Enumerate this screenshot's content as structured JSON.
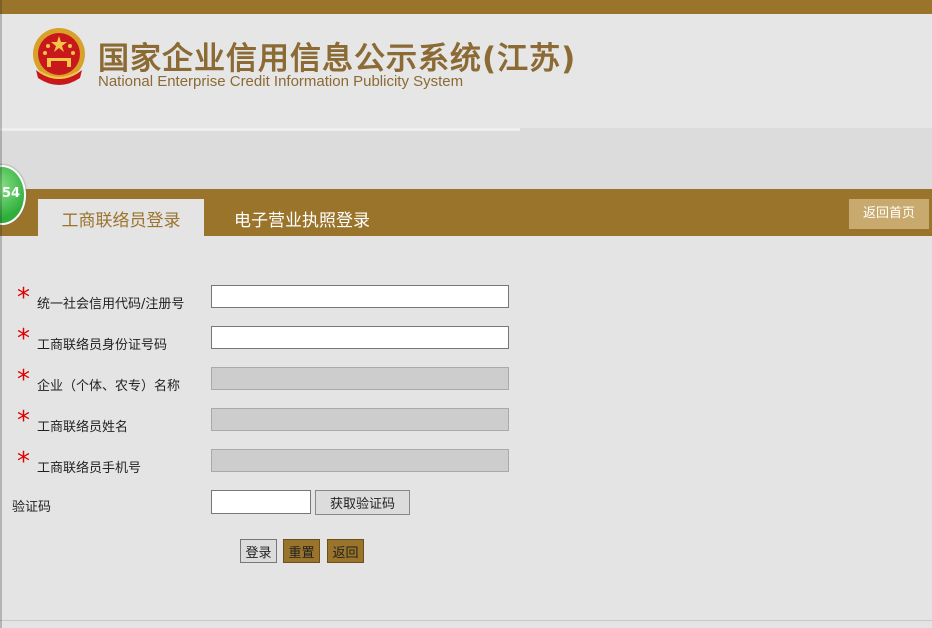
{
  "header": {
    "title_cn": "国家企业信用信息公示系统(江苏)",
    "title_en": "National Enterprise Credit Information Publicity System"
  },
  "nav": {
    "tabs": [
      {
        "label": "工商联络员登录",
        "active": true
      },
      {
        "label": "电子营业执照登录",
        "active": false
      }
    ],
    "home_label": "返回首页"
  },
  "bubble_text": "54",
  "form": {
    "fields": [
      {
        "label": "统一社会信用代码/注册号",
        "required": true,
        "value": "",
        "disabled": false
      },
      {
        "label": "工商联络员身份证号码",
        "required": true,
        "value": "",
        "disabled": false
      },
      {
        "label": "企业（个体、农专）名称",
        "required": true,
        "value": "",
        "disabled": true
      },
      {
        "label": "工商联络员姓名",
        "required": true,
        "value": "",
        "disabled": true
      },
      {
        "label": "工商联络员手机号",
        "required": true,
        "value": "",
        "disabled": true
      }
    ],
    "required_mark": "*",
    "captcha_label": "验证码",
    "captcha_value": "",
    "get_code_label": "获取验证码",
    "login_label": "登录",
    "reset_label": "重置",
    "back_label": "返回"
  },
  "colors": {
    "brand": "#9b742b",
    "required": "#e00000"
  }
}
